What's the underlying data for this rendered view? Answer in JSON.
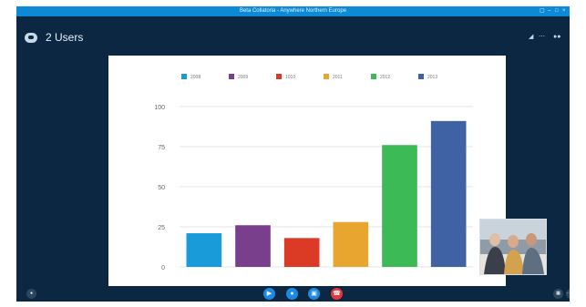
{
  "window": {
    "title": "Beta Collatoria - Anywhere Northern Europe"
  },
  "title_bar_icons": [
    "restore-icon",
    "minimize-icon",
    "maximize-icon",
    "close-icon"
  ],
  "header": {
    "users_icon": "users-icon",
    "users_label": "2 Users",
    "right_icons": [
      "signal-icon",
      "more-icon",
      "participants-icon"
    ]
  },
  "colors": {
    "title_bar": "#0c8ad6",
    "window_bg": "#0b2742",
    "control_blue": "#1b8ae0",
    "hangup_red": "#e4353b"
  },
  "chart_data": {
    "type": "bar",
    "categories": [
      "2008",
      "2009",
      "1010",
      "2011",
      "2012",
      "2013"
    ],
    "values": [
      21,
      26,
      18,
      28,
      76,
      91
    ],
    "colors": [
      "#199bd9",
      "#7a3f8c",
      "#db3a26",
      "#e8a630",
      "#3cba56",
      "#3e62a3"
    ],
    "legend": [
      "2008",
      "2009",
      "1010",
      "2011",
      "2012",
      "2013"
    ],
    "yticks": [
      0,
      25,
      50,
      75,
      100
    ],
    "ylim": [
      0,
      100
    ],
    "title": "",
    "xlabel": "",
    "ylabel": "",
    "grid": true,
    "legend_position": "top"
  },
  "controls": {
    "left_icon": "chat-icon",
    "buttons": [
      "video-icon",
      "mic-icon",
      "screen-share-icon",
      "hang-up-icon"
    ],
    "right_icons": [
      "devices-icon",
      "more-options-icon"
    ]
  }
}
